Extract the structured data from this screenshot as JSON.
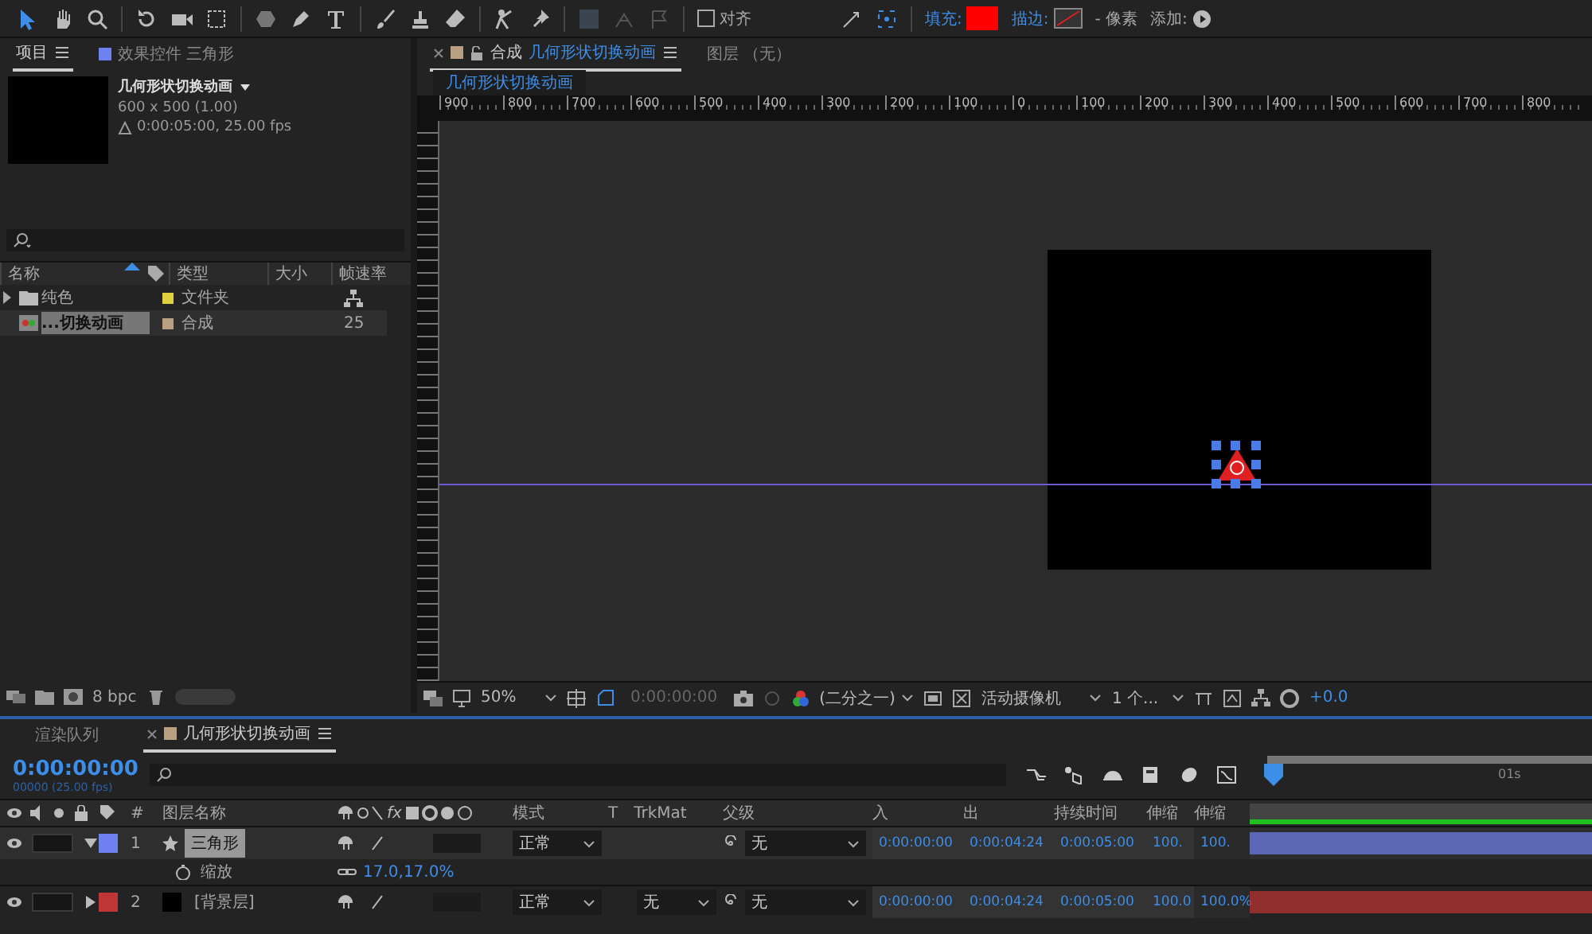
{
  "toolbar": {
    "snap_label": "对齐",
    "snap_checked": false,
    "fill_label": "填充:",
    "fill": {
      "color": "#ff0000"
    },
    "stroke_label": "描边:",
    "stroke_unit": "- 像素",
    "add_label": "添加:"
  },
  "project": {
    "tabs": [
      {
        "label": "项目",
        "selected": true
      },
      {
        "label": "效果控件 三角形",
        "selected": false,
        "color": "#6f80f0"
      }
    ],
    "preview": {
      "title": "几何形状切换动画",
      "size": "600 x 500 (1.00)",
      "duration": "0:00:05:00, 25.00 fps"
    },
    "columns": [
      "名称",
      "类型",
      "大小",
      "帧速率"
    ],
    "items": [
      {
        "kind": "folder",
        "name": "纯色",
        "type": "文件夹",
        "color": "#e0d040",
        "selected": false
      },
      {
        "kind": "comp",
        "name": "...切换动画",
        "type": "合成",
        "fps": "25",
        "color": "#b8a080",
        "selected": true
      }
    ],
    "bpc": "8 bpc"
  },
  "viewer": {
    "tabs": [
      {
        "prefix": "合成",
        "label": "几何形状切换动画",
        "selected": true,
        "color": "#b8a080"
      },
      {
        "label": "图层 （无）",
        "selected": false
      }
    ],
    "breadcrumb": "几何形状切换动画",
    "ruler": [
      "900",
      "800",
      "700",
      "600",
      "500",
      "400",
      "300",
      "200",
      "100",
      "0",
      "100",
      "200",
      "300",
      "400",
      "500",
      "600",
      "700",
      "800"
    ],
    "zoom": "50%",
    "timecode": "0:00:00:00",
    "resolution": "(二分之一)",
    "camera": "活动摄像机",
    "views": "1 个...",
    "exposure": "+0.0"
  },
  "timeline": {
    "tabs": [
      {
        "label": "渲染队列",
        "selected": false
      },
      {
        "label": "几何形状切换动画",
        "selected": true,
        "color": "#b8a080"
      }
    ],
    "timecode": "0:00:00:00",
    "frame": "00000 (25.00 fps)",
    "fx_label": "fx",
    "columns": [
      "#",
      "图层名称",
      "模式",
      "T",
      "TrkMat",
      "父级",
      "入",
      "出",
      "持续时间",
      "伸缩",
      "伸缩"
    ],
    "time_label": "01s",
    "layers": [
      {
        "num": "1",
        "name": "三角形",
        "color": "#6f80f0",
        "expanded": true,
        "selected": true,
        "mode": "正常",
        "parent": "无",
        "in": "0:00:00:00",
        "out": "0:00:04:24",
        "duration": "0:00:05:00",
        "stretch": "100.",
        "stretch2": "100.",
        "properties": [
          {
            "name": "缩放",
            "value": "17.0,17.0%"
          }
        ]
      },
      {
        "num": "2",
        "name": "[背景层]",
        "color": "#c03535",
        "expanded": false,
        "selected": false,
        "mode": "正常",
        "trkmat": "无",
        "parent": "无",
        "in": "0:00:00:00",
        "out": "0:00:04:24",
        "duration": "0:00:05:00",
        "stretch": "100.0",
        "stretch2": "100.0%"
      }
    ]
  }
}
